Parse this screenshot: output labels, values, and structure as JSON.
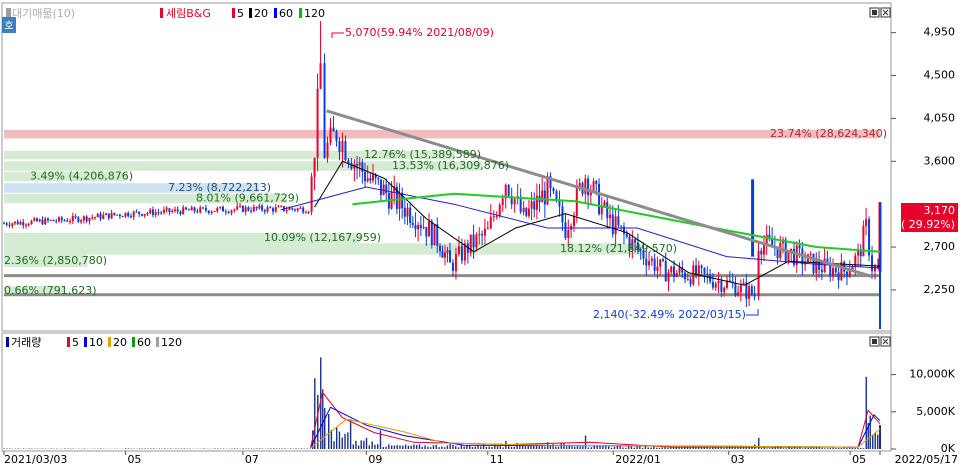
{
  "legend_price": {
    "stock": "세림B&G",
    "items": [
      {
        "label": "대기매물(10)",
        "color": "#9e9e9e"
      },
      {
        "label": "세림B&G",
        "color": "#e8002a"
      },
      {
        "label": "5",
        "color": "#e8002a"
      },
      {
        "label": "20",
        "color": "#000000"
      },
      {
        "label": "60",
        "color": "#0000ee"
      },
      {
        "label": "120",
        "color": "#00c000"
      }
    ]
  },
  "legend_volume": {
    "items": [
      {
        "label": "거래량",
        "color": "#0000aa"
      },
      {
        "label": "5",
        "color": "#e8002a"
      },
      {
        "label": "10",
        "color": "#0000ee"
      },
      {
        "label": "20",
        "color": "#e0a000"
      },
      {
        "label": "60",
        "color": "#00a000"
      },
      {
        "label": "120",
        "color": "#9e9e9e"
      }
    ]
  },
  "corner_tag": "호",
  "colors": {
    "up": "#e8002a",
    "down": "#0a3dde",
    "ma5": "#e8002a",
    "ma20": "#000000",
    "ma60": "#1f1fd0",
    "ma120": "#22cc22",
    "trend": "#8c8c8c",
    "zone_green": "#cfe8cc",
    "zone_blue": "#c4dcef",
    "zone_red": "#efb0b3",
    "current": "#e8002a"
  },
  "chart_data": [
    {
      "type": "candlestick",
      "title": "세림B&G",
      "y_ticks": [
        "4,950",
        "4,500",
        "4,050",
        "3,600",
        "2,700",
        "2,250"
      ],
      "y_tick_values": [
        4950,
        4500,
        4050,
        3600,
        2700,
        2250
      ],
      "ylim": [
        1840,
        5240
      ],
      "x_ticks": [
        "2021/03/03",
        "05",
        "07",
        "09",
        "11",
        "2022/01",
        "03",
        "05",
        "2022/05/17"
      ],
      "max_annotation": "5,070(59.94% 2021/08/09)",
      "min_annotation": "2,140(-32.49% 2022/03/15)",
      "current_price": "3,170",
      "current_change": "( 29.92%)",
      "volume_profile": [
        {
          "label": "23.74% (28,624,340)",
          "low": 3840,
          "high": 3930,
          "pct": 23.74,
          "color": "red"
        },
        {
          "label": "12.76% (15,389,589)",
          "low": 3620,
          "high": 3710,
          "pct": 12.76,
          "color": "green"
        },
        {
          "label": "13.53% (16,309,876)",
          "low": 3500,
          "high": 3600,
          "pct": 13.53,
          "color": "green"
        },
        {
          "label": "3.49% (4,206,876)",
          "low": 3390,
          "high": 3490,
          "pct": 3.49,
          "color": "green"
        },
        {
          "label": "7.23% (8,722,213)",
          "low": 3270,
          "high": 3370,
          "pct": 7.23,
          "color": "blue"
        },
        {
          "label": "8.01% (9,661,729)",
          "low": 3160,
          "high": 3260,
          "pct": 8.01,
          "color": "green"
        },
        {
          "label": "10.09% (12,167,959)",
          "low": 2740,
          "high": 2850,
          "pct": 10.09,
          "color": "green"
        },
        {
          "label": "18.12% (21,849,570)",
          "low": 2620,
          "high": 2740,
          "pct": 18.12,
          "color": "green"
        },
        {
          "label": "2.36% (2,850,780)",
          "low": 2490,
          "high": 2620,
          "pct": 2.36,
          "color": "green"
        },
        {
          "label": "0.66% (791,623)",
          "low": 2190,
          "high": 2290,
          "pct": 0.66,
          "color": "green"
        }
      ],
      "horizontal_lines": [
        2400,
        2200
      ],
      "trendline": [
        {
          "date": "2021-08-12",
          "price": 4130
        },
        {
          "date": "2022-05-13",
          "price": 2390
        }
      ],
      "ohlc_approx": [
        {
          "date": "2021-03-03",
          "close": 2950
        },
        {
          "date": "2021-04-01",
          "close": 2980
        },
        {
          "date": "2021-05-03",
          "close": 3050
        },
        {
          "date": "2021-06-01",
          "close": 3080
        },
        {
          "date": "2021-07-01",
          "close": 3100
        },
        {
          "date": "2021-08-03",
          "close": 3100
        },
        {
          "date": "2021-08-06",
          "close": 3750
        },
        {
          "date": "2021-08-09",
          "close": 4600,
          "high": 5070
        },
        {
          "date": "2021-08-11",
          "close": 3700
        },
        {
          "date": "2021-08-17",
          "close": 3900
        },
        {
          "date": "2021-08-20",
          "close": 3800
        },
        {
          "date": "2021-08-26",
          "close": 3600
        },
        {
          "date": "2021-09-03",
          "close": 3400
        },
        {
          "date": "2021-09-15",
          "close": 3200
        },
        {
          "date": "2021-09-27",
          "close": 3000
        },
        {
          "date": "2021-10-08",
          "close": 2750
        },
        {
          "date": "2021-10-13",
          "close": 2500
        },
        {
          "date": "2021-10-22",
          "close": 2700
        },
        {
          "date": "2021-11-01",
          "close": 2850
        },
        {
          "date": "2021-11-10",
          "close": 3400
        },
        {
          "date": "2021-11-19",
          "close": 3000
        },
        {
          "date": "2021-12-01",
          "close": 3300
        },
        {
          "date": "2021-12-10",
          "close": 2900
        },
        {
          "date": "2021-12-20",
          "close": 3450
        },
        {
          "date": "2021-12-31",
          "close": 3000
        },
        {
          "date": "2022-01-14",
          "close": 2700
        },
        {
          "date": "2022-01-28",
          "close": 2450
        },
        {
          "date": "2022-02-15",
          "close": 2400
        },
        {
          "date": "2022-03-04",
          "close": 2300
        },
        {
          "date": "2022-03-15",
          "close": 2200,
          "low": 2140
        },
        {
          "date": "2022-03-17",
          "close": 2750
        },
        {
          "date": "2022-04-01",
          "close": 2650
        },
        {
          "date": "2022-04-15",
          "close": 2500
        },
        {
          "date": "2022-04-29",
          "close": 2450
        },
        {
          "date": "2022-05-06",
          "close": 2600
        },
        {
          "date": "2022-05-10",
          "close": 2900
        },
        {
          "date": "2022-05-13",
          "close": 2500
        },
        {
          "date": "2022-05-16",
          "close": 2440
        },
        {
          "date": "2022-05-17",
          "close": 3170
        }
      ],
      "moving_averages": {
        "ma20": [
          {
            "date": "2021-08-06",
            "v": 3120
          },
          {
            "date": "2021-08-20",
            "v": 3600
          },
          {
            "date": "2021-09-10",
            "v": 3420
          },
          {
            "date": "2021-10-01",
            "v": 3000
          },
          {
            "date": "2021-10-25",
            "v": 2650
          },
          {
            "date": "2021-11-15",
            "v": 2900
          },
          {
            "date": "2021-12-10",
            "v": 3050
          },
          {
            "date": "2022-01-10",
            "v": 2850
          },
          {
            "date": "2022-02-10",
            "v": 2430
          },
          {
            "date": "2022-03-10",
            "v": 2300
          },
          {
            "date": "2022-04-01",
            "v": 2550
          },
          {
            "date": "2022-05-17",
            "v": 2500
          }
        ],
        "ma60": [
          {
            "date": "2021-07-20",
            "v": 3090
          },
          {
            "date": "2021-09-01",
            "v": 3330
          },
          {
            "date": "2021-10-15",
            "v": 3150
          },
          {
            "date": "2021-12-01",
            "v": 2900
          },
          {
            "date": "2022-01-15",
            "v": 2900
          },
          {
            "date": "2022-03-01",
            "v": 2600
          },
          {
            "date": "2022-04-15",
            "v": 2520
          },
          {
            "date": "2022-05-17",
            "v": 2480
          }
        ],
        "ma120": [
          {
            "date": "2021-08-25",
            "v": 3150
          },
          {
            "date": "2021-10-15",
            "v": 3260
          },
          {
            "date": "2021-12-15",
            "v": 3180
          },
          {
            "date": "2022-02-15",
            "v": 2930
          },
          {
            "date": "2022-04-15",
            "v": 2700
          },
          {
            "date": "2022-05-17",
            "v": 2650
          }
        ]
      }
    },
    {
      "type": "bar",
      "title": "거래량",
      "y_ticks": [
        "10,000K",
        "5,000K",
        "0K"
      ],
      "y_tick_values": [
        10000,
        5000,
        0
      ],
      "ylim": [
        0,
        13300
      ],
      "unit": "K",
      "volume_approx": [
        {
          "date": "2021-03-03",
          "v": 80
        },
        {
          "date": "2021-05-03",
          "v": 90
        },
        {
          "date": "2021-07-01",
          "v": 100
        },
        {
          "date": "2021-08-05",
          "v": 2500
        },
        {
          "date": "2021-08-06",
          "v": 9500
        },
        {
          "date": "2021-08-09",
          "v": 12300
        },
        {
          "date": "2021-08-10",
          "v": 8000
        },
        {
          "date": "2021-08-11",
          "v": 5500
        },
        {
          "date": "2021-08-13",
          "v": 4700
        },
        {
          "date": "2021-08-17",
          "v": 3000
        },
        {
          "date": "2021-08-24",
          "v": 4000
        },
        {
          "date": "2021-09-01",
          "v": 1500
        },
        {
          "date": "2021-09-08",
          "v": 2500
        },
        {
          "date": "2021-10-13",
          "v": 700
        },
        {
          "date": "2021-11-10",
          "v": 1100
        },
        {
          "date": "2021-12-01",
          "v": 900
        },
        {
          "date": "2021-12-20",
          "v": 1800
        },
        {
          "date": "2022-01-05",
          "v": 500
        },
        {
          "date": "2022-03-15",
          "v": 600
        },
        {
          "date": "2022-03-17",
          "v": 1500
        },
        {
          "date": "2022-04-15",
          "v": 300
        },
        {
          "date": "2022-05-10",
          "v": 9700
        },
        {
          "date": "2022-05-11",
          "v": 3500
        },
        {
          "date": "2022-05-12",
          "v": 4500
        },
        {
          "date": "2022-05-17",
          "v": 3200
        }
      ]
    }
  ]
}
